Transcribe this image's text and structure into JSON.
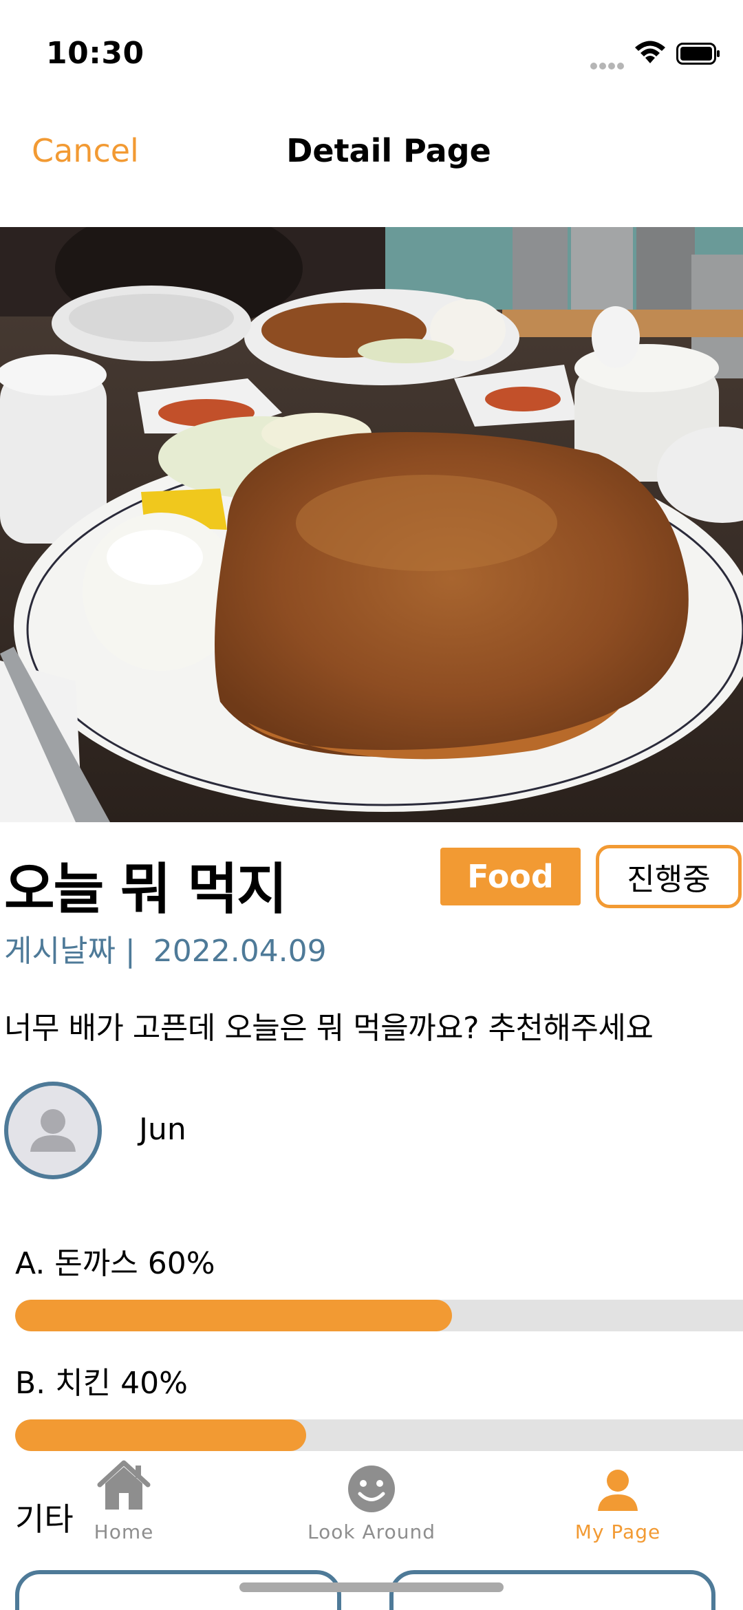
{
  "status_bar": {
    "time": "10:30"
  },
  "nav": {
    "cancel_label": "Cancel",
    "title": "Detail Page"
  },
  "post": {
    "title": "오늘 뭐 먹지",
    "category": "Food",
    "status": "진행중",
    "date_label": "게시날짜 |",
    "date_value": "2022.04.09",
    "body": "너무 배가 고픈데 오늘은 뭐 먹을까요? 추천해주세요"
  },
  "author": {
    "name": "Jun"
  },
  "poll": {
    "options": [
      {
        "label": "A. 돈까스 60%",
        "fraction": 0.6
      },
      {
        "label": "B. 치킨 40%",
        "fraction": 0.4
      }
    ]
  },
  "etc": {
    "label": "기타"
  },
  "tabs": [
    {
      "label": "Home",
      "icon": "house-icon",
      "active": false
    },
    {
      "label": "Look Around",
      "icon": "smiley-icon",
      "active": false
    },
    {
      "label": "My Page",
      "icon": "person-icon",
      "active": true
    }
  ],
  "colors": {
    "accent": "#f29a33",
    "secondary": "#4e7a98",
    "inactive": "#8e8e8e"
  }
}
